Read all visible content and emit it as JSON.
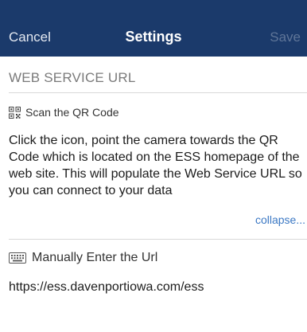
{
  "navbar": {
    "cancel_label": "Cancel",
    "title": "Settings",
    "save_label": "Save",
    "background": "#1b3a6b"
  },
  "section": {
    "header": "WEB SERVICE URL"
  },
  "qr": {
    "icon": "qr-code-icon",
    "label": "Scan the QR Code",
    "description": "Click the icon, point the camera towards the QR Code which is located on the ESS homepage of the web site. This will populate the Web Service URL so you can connect to your data",
    "collapse_label": "collapse..."
  },
  "manual": {
    "icon": "keyboard-icon",
    "label": "Manually Enter the Url",
    "url_value": "https://ess.davenportiowa.com/ess"
  },
  "colors": {
    "link": "#3b78c4",
    "header_text": "#7a7a7a"
  }
}
